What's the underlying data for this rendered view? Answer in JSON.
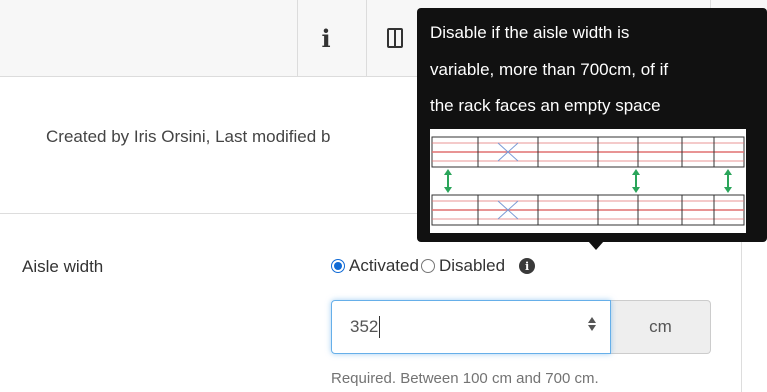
{
  "toolbar": {
    "info_glyph": "i",
    "close_glyph": "✕"
  },
  "meta": {
    "created_text": "Created by Iris Orsini, Last modified b"
  },
  "field": {
    "label": "Aisle width",
    "radio_options": [
      {
        "label": "Activated",
        "checked": true
      },
      {
        "label": "Disabled",
        "checked": false
      }
    ],
    "info_glyph": "i",
    "value": "352",
    "unit": "cm",
    "help": "Required. Between 100 cm and 700 cm."
  },
  "tooltip": {
    "lines": [
      "Disable if the aisle width is",
      "variable, more than 700cm, of if",
      "the rack faces an empty space"
    ]
  },
  "colors": {
    "accent": "#0f6ad6",
    "focus_border": "#66afe9",
    "tooltip_bg": "#111111",
    "rack_line": "#e07070",
    "arrow_green": "#2aa55a"
  }
}
